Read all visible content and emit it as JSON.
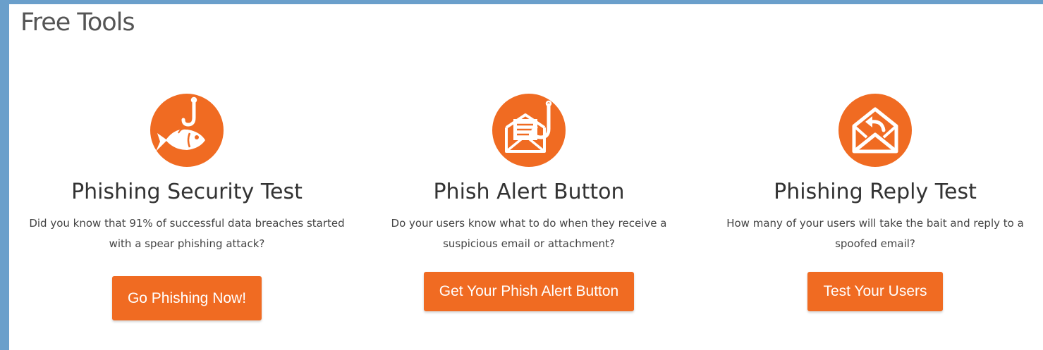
{
  "section": {
    "title": "Free Tools"
  },
  "colors": {
    "accent": "#f06b22",
    "frame": "#6a9fcb"
  },
  "cards": [
    {
      "icon": "fish-hook-icon",
      "title": "Phishing Security Test",
      "description": "Did you know that 91% of successful data breaches started with a spear phishing attack?",
      "button_label": "Go Phishing Now!"
    },
    {
      "icon": "email-hook-icon",
      "title": "Phish Alert Button",
      "description": "Do your users know what to do when they receive a suspicious email or attachment?",
      "button_label": "Get Your Phish Alert Button"
    },
    {
      "icon": "reply-envelope-icon",
      "title": "Phishing Reply Test",
      "description": "How many of your users will take the bait and reply to a spoofed email?",
      "button_label": "Test Your Users"
    }
  ]
}
